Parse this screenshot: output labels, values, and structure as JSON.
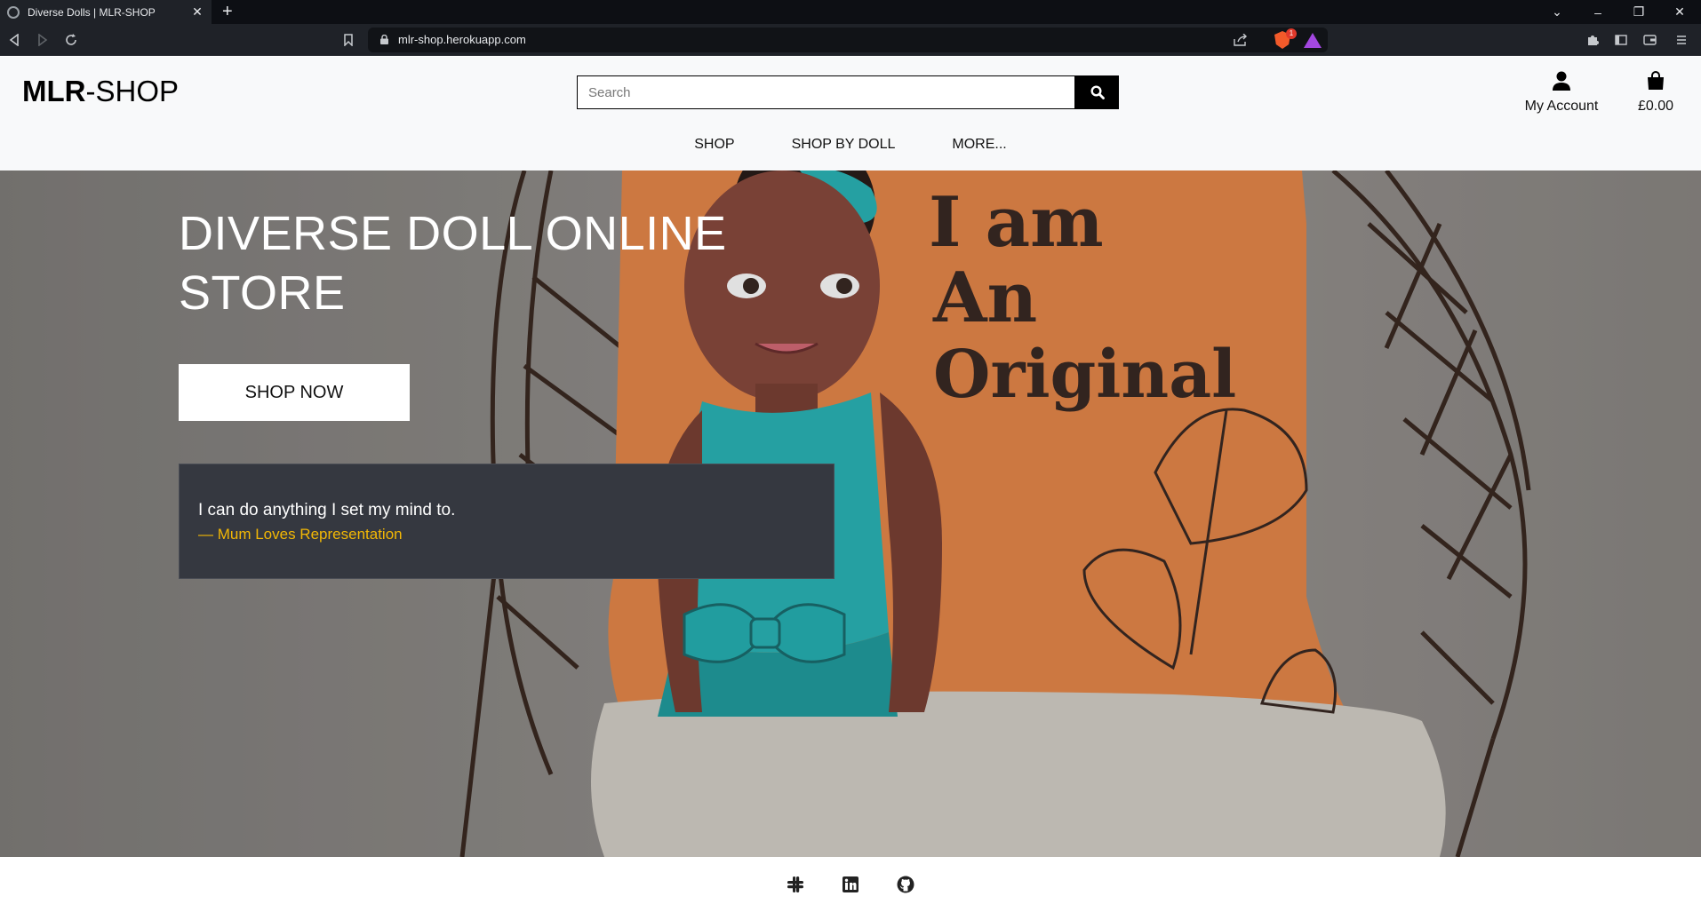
{
  "browser": {
    "tab_title": "Diverse Dolls | MLR-SHOP",
    "url": "mlr-shop.herokuapp.com",
    "badge_count": "1"
  },
  "header": {
    "logo_bold": "MLR",
    "logo_rest": "-SHOP",
    "search_placeholder": "Search",
    "account_label": "My Account",
    "cart_total": "£0.00",
    "icons": [
      "search-icon",
      "user-icon",
      "shopping-bag-icon"
    ]
  },
  "nav": {
    "items": [
      "SHOP",
      "SHOP BY DOLL",
      "MORE..."
    ]
  },
  "hero": {
    "title": "DIVERSE DOLL ONLINE STORE",
    "button_label": "SHOP NOW",
    "pillow_text": [
      "I am",
      "An",
      "Original"
    ],
    "quote_text": "I can do anything I set my mind to.",
    "quote_author": "— Mum Loves Representation"
  },
  "footer": {
    "social_icons": [
      "slack-icon",
      "linkedin-icon",
      "github-icon"
    ]
  },
  "colors": {
    "header_bg": "#f8f9fa",
    "quote_bg": "#353840",
    "quote_author": "#f2b705",
    "pillow": "#e9894a",
    "dress": "#2bb7b9"
  }
}
